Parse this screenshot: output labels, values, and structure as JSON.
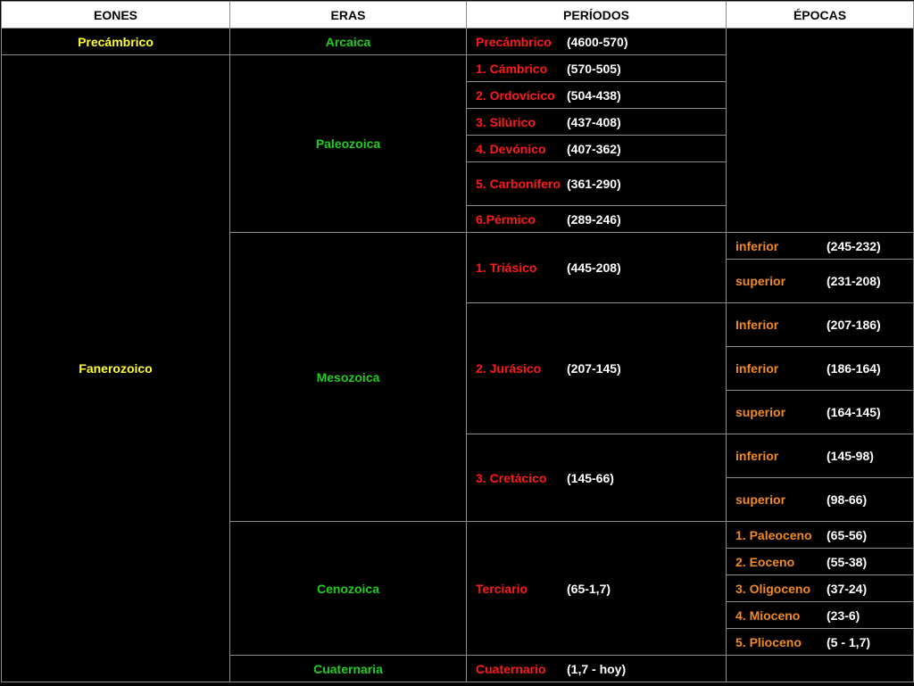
{
  "headers": {
    "eones": "EONES",
    "eras": "ERAS",
    "periodos": "PERÍODOS",
    "epocas": "ÉPOCAS"
  },
  "rows": {
    "precambrico": {
      "eon": "Precámbrico",
      "era": "Arcaica",
      "period_name": "Precámbrico",
      "period_range": "(4600-570)"
    },
    "fanerozoico": {
      "eon": "Fanerozoico"
    },
    "paleozoica": {
      "era": "Paleozoica",
      "periods": [
        {
          "name": "1. Cámbrico",
          "range": "(570-505)"
        },
        {
          "name": "2. Ordovícico",
          "range": "(504-438)"
        },
        {
          "name": "3. Silúrico",
          "range": "(437-408)"
        },
        {
          "name": "4. Devónico",
          "range": "(407-362)"
        },
        {
          "name": "5. Carbonífero",
          "range": "(361-290)"
        },
        {
          "name": "6.Pérmico",
          "range": "(289-246)"
        }
      ]
    },
    "mesozoica": {
      "era": "Mesozoica",
      "triasico": {
        "name": "1. Triásico",
        "range": "(445-208)",
        "epochs": [
          {
            "name": "inferior",
            "range": "(245-232)"
          },
          {
            "name": "superior",
            "range": "(231-208)"
          }
        ]
      },
      "jurasico": {
        "name": "2. Jurásico",
        "range": "(207-145)",
        "epochs": [
          {
            "name": "Inferior",
            "range": "(207-186)"
          },
          {
            "name": "inferior",
            "range": "(186-164)"
          },
          {
            "name": "superior",
            "range": "(164-145)"
          }
        ]
      },
      "cretacico": {
        "name": "3. Cretácico",
        "range": "(145-66)",
        "epochs": [
          {
            "name": "inferior",
            "range": "(145-98)"
          },
          {
            "name": "superior",
            "range": "(98-66)"
          }
        ]
      }
    },
    "cenozoica": {
      "era": "Cenozoica",
      "terciario": {
        "name": "Terciario",
        "range": "(65-1,7)",
        "epochs": [
          {
            "name": "1. Paleoceno",
            "range": "(65-56)"
          },
          {
            "name": "2. Eoceno",
            "range": "(55-38)"
          },
          {
            "name": "3. Oligoceno",
            "range": "(37-24)"
          },
          {
            "name": "4. Mioceno",
            "range": "(23-6)"
          },
          {
            "name": "5. Plioceno",
            "range": "(5 - 1,7)"
          }
        ]
      }
    },
    "cuaternaria": {
      "era": "Cuaternaria",
      "period_name": "Cuaternario",
      "period_range": "(1,7 - hoy)"
    }
  },
  "colors": {
    "eon": "#ffff33",
    "era": "#22cc22",
    "period": "#ff1a1a",
    "epoch": "#f08a24",
    "range": "#ffffff",
    "header_bg": "#ffffff"
  }
}
